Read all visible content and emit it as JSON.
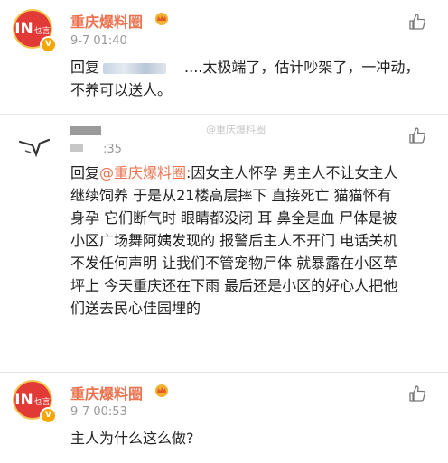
{
  "comments": [
    {
      "author": "重庆爆料圈",
      "time": "9-7 01:40",
      "reply_prefix": "回复",
      "text": "....太极端了，估计吵架了，一冲动，不养可以送人。",
      "avatar_main": "IN",
      "avatar_sub": "乜言"
    },
    {
      "author": "",
      "time": ":35",
      "reply_prefix": "回复",
      "mention": "@重庆爆料圈",
      "text": ":因女主人怀孕 男主人不让女主人继续饲养 于是从21楼高层摔下 直接死亡 猫猫怀有身孕 它们断气时 眼睛都没闭 耳 鼻全是血 尸体是被小区广场舞阿姨发现的 报警后主人不开门 电话关机 不发任何声明 让我们不管宠物尸体 就暴露在小区草坪上 今天重庆还在下雨 最后还是小区的好心人把他们送去民心佳园埋的",
      "watermark": "@重庆爆料圈"
    },
    {
      "author": "重庆爆料圈",
      "time": "9-7 00:53",
      "text": "主人为什么这么做?",
      "avatar_main": "IN",
      "avatar_sub": "乜言"
    }
  ],
  "icons": {
    "like": "thumbs-up-icon",
    "verified": "v-badge-icon",
    "crown": "crown-emoji-icon"
  },
  "colors": {
    "name": "#eb7350",
    "mention": "#eb7350",
    "time": "#999999",
    "logo_red": "#e23a36",
    "badge": "#f7a600"
  }
}
